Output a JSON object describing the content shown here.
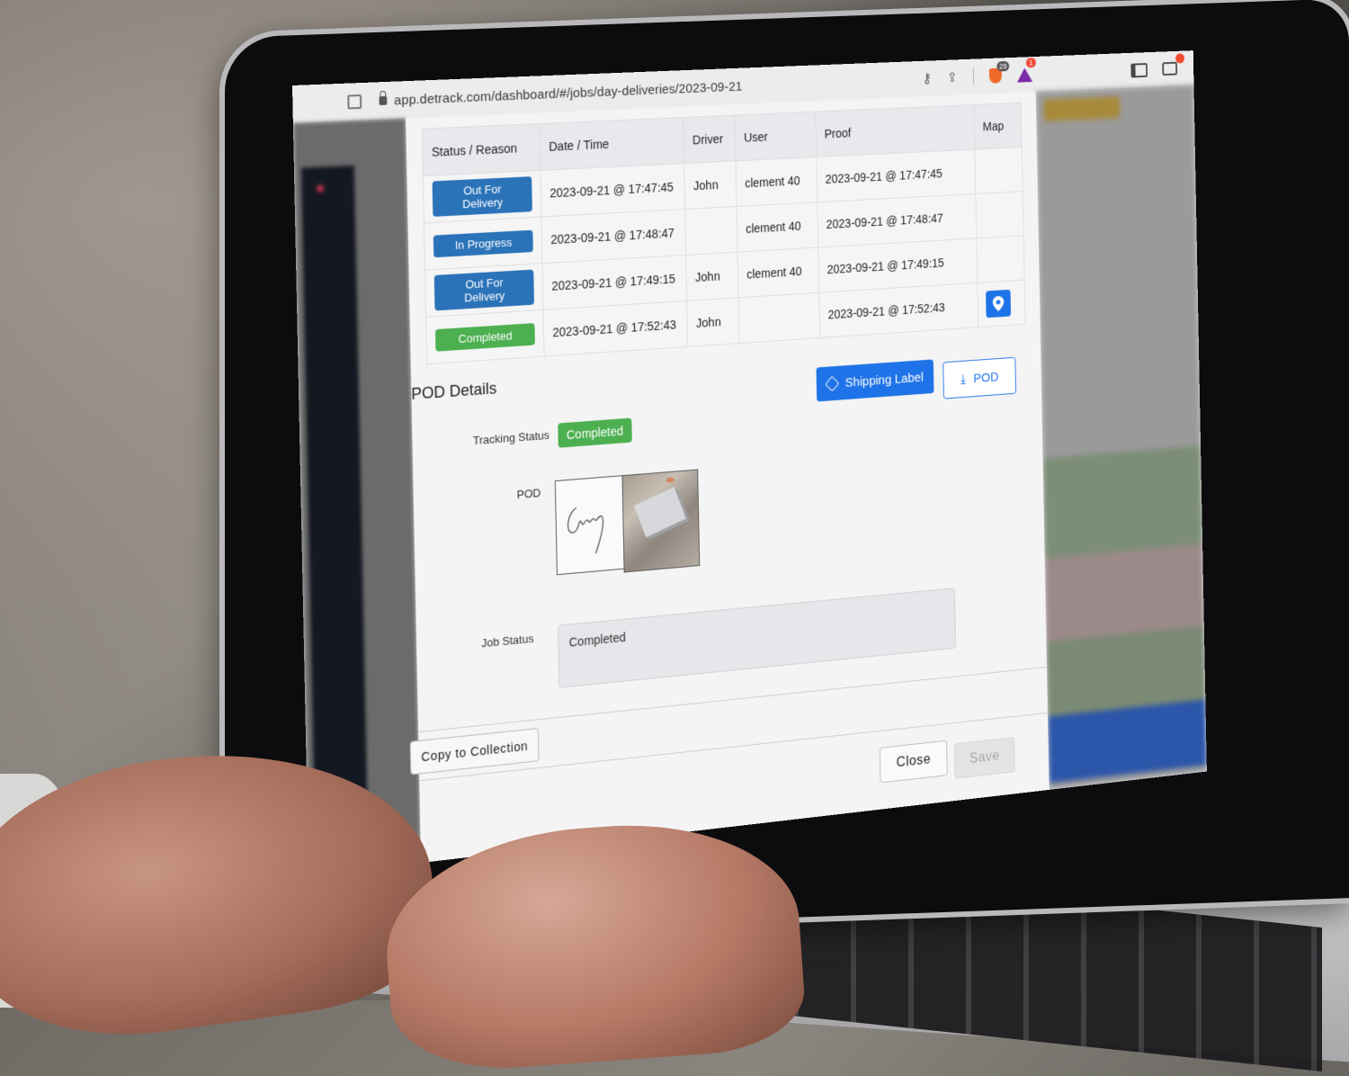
{
  "browser": {
    "url": "app.detrack.com/dashboard/#/jobs/day-deliveries/2023-09-21",
    "extensions": {
      "brave_shield_count": "29",
      "bat_rewards_count": "1"
    }
  },
  "history_table": {
    "headers": [
      "Status / Reason",
      "Date / Time",
      "Driver",
      "User",
      "Proof",
      "Map"
    ],
    "rows": [
      {
        "status": "Out For Delivery",
        "status_color": "#2b73b8",
        "datetime": "2023-09-21 @ 17:47:45",
        "driver": "John",
        "user": "clement 40",
        "proof": "2023-09-21 @ 17:47:45",
        "has_map": false
      },
      {
        "status": "In Progress",
        "status_color": "#2b73b8",
        "datetime": "2023-09-21 @ 17:48:47",
        "driver": "",
        "user": "clement 40",
        "proof": "2023-09-21 @ 17:48:47",
        "has_map": false
      },
      {
        "status": "Out For Delivery",
        "status_color": "#2b73b8",
        "datetime": "2023-09-21 @ 17:49:15",
        "driver": "John",
        "user": "clement 40",
        "proof": "2023-09-21 @ 17:49:15",
        "has_map": false
      },
      {
        "status": "Completed",
        "status_color": "#4caf50",
        "datetime": "2023-09-21 @ 17:52:43",
        "driver": "John",
        "user": "",
        "proof": "2023-09-21 @ 17:52:43",
        "has_map": true
      }
    ]
  },
  "pod_details": {
    "title": "POD Details",
    "shipping_label_button": "Shipping Label",
    "pod_download_button": "POD",
    "tracking_status_label": "Tracking Status",
    "tracking_status_value": "Completed",
    "pod_label": "POD",
    "signature_text": "Andy",
    "job_status_label": "Job Status",
    "job_status_value": "Completed"
  },
  "footer": {
    "copy_to_collection": "Copy to Collection",
    "close": "Close",
    "save": "Save"
  },
  "colors": {
    "primary_blue": "#1f73e8",
    "status_blue": "#2b73b8",
    "status_green": "#4caf50"
  }
}
